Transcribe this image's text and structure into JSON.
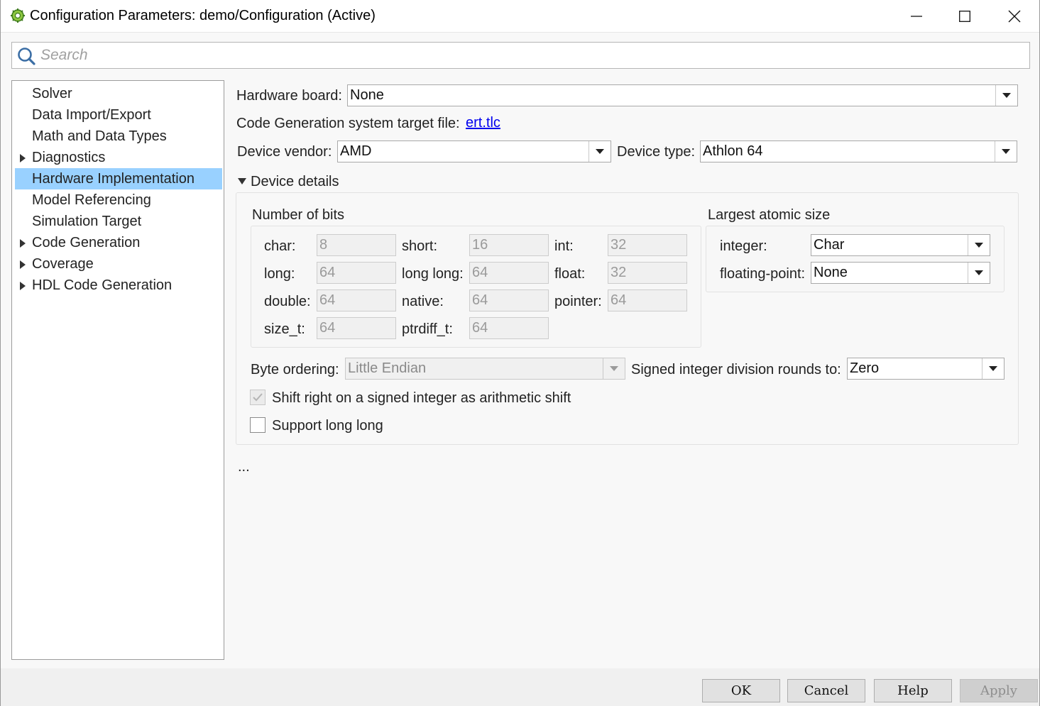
{
  "window": {
    "title": "Configuration Parameters: demo/Configuration (Active)",
    "icons": {
      "app": "gear-app-icon",
      "minimize": "minimize-icon",
      "maximize": "maximize-icon",
      "close": "close-icon"
    }
  },
  "search": {
    "placeholder": "Search",
    "value": ""
  },
  "tree": {
    "items": [
      {
        "label": "Solver",
        "expandable": false,
        "selected": false
      },
      {
        "label": "Data Import/Export",
        "expandable": false,
        "selected": false
      },
      {
        "label": "Math and Data Types",
        "expandable": false,
        "selected": false
      },
      {
        "label": "Diagnostics",
        "expandable": true,
        "selected": false
      },
      {
        "label": "Hardware Implementation",
        "expandable": false,
        "selected": true
      },
      {
        "label": "Model Referencing",
        "expandable": false,
        "selected": false
      },
      {
        "label": "Simulation Target",
        "expandable": false,
        "selected": false
      },
      {
        "label": "Code Generation",
        "expandable": true,
        "selected": false
      },
      {
        "label": "Coverage",
        "expandable": true,
        "selected": false
      },
      {
        "label": "HDL Code Generation",
        "expandable": true,
        "selected": false
      }
    ],
    "selection_color": "#99d1ff"
  },
  "hardware": {
    "board_label": "Hardware board:",
    "board_value": "None",
    "target_label": "Code Generation system target file:",
    "target_link": "ert.tlc",
    "vendor_label": "Device vendor:",
    "vendor_value": "AMD",
    "type_label": "Device type:",
    "type_value": "Athlon 64",
    "details_label": "Device details",
    "bits": {
      "title": "Number of bits",
      "char_label": "char:",
      "char_value": "8",
      "short_label": "short:",
      "short_value": "16",
      "int_label": "int:",
      "int_value": "32",
      "long_label": "long:",
      "long_value": "64",
      "longlong_label": "long long:",
      "longlong_value": "64",
      "float_label": "float:",
      "float_value": "32",
      "double_label": "double:",
      "double_value": "64",
      "native_label": "native:",
      "native_value": "64",
      "pointer_label": "pointer:",
      "pointer_value": "64",
      "sizet_label": "size_t:",
      "sizet_value": "64",
      "ptrdiff_label": "ptrdiff_t:",
      "ptrdiff_value": "64"
    },
    "atomic": {
      "title": "Largest atomic size",
      "integer_label": "integer:",
      "integer_value": "Char",
      "float_label": "floating-point:",
      "float_value": "None"
    },
    "byte_ordering_label": "Byte ordering:",
    "byte_ordering_value": "Little Endian",
    "division_label": "Signed integer division rounds to:",
    "division_value": "Zero",
    "shift_label": "Shift right on a signed integer as arithmetic shift",
    "shift_checked": true,
    "longlong_support_label": "Support long long",
    "longlong_support_checked": false,
    "more": "..."
  },
  "buttons": {
    "ok": "OK",
    "cancel": "Cancel",
    "help": "Help",
    "apply": "Apply"
  }
}
